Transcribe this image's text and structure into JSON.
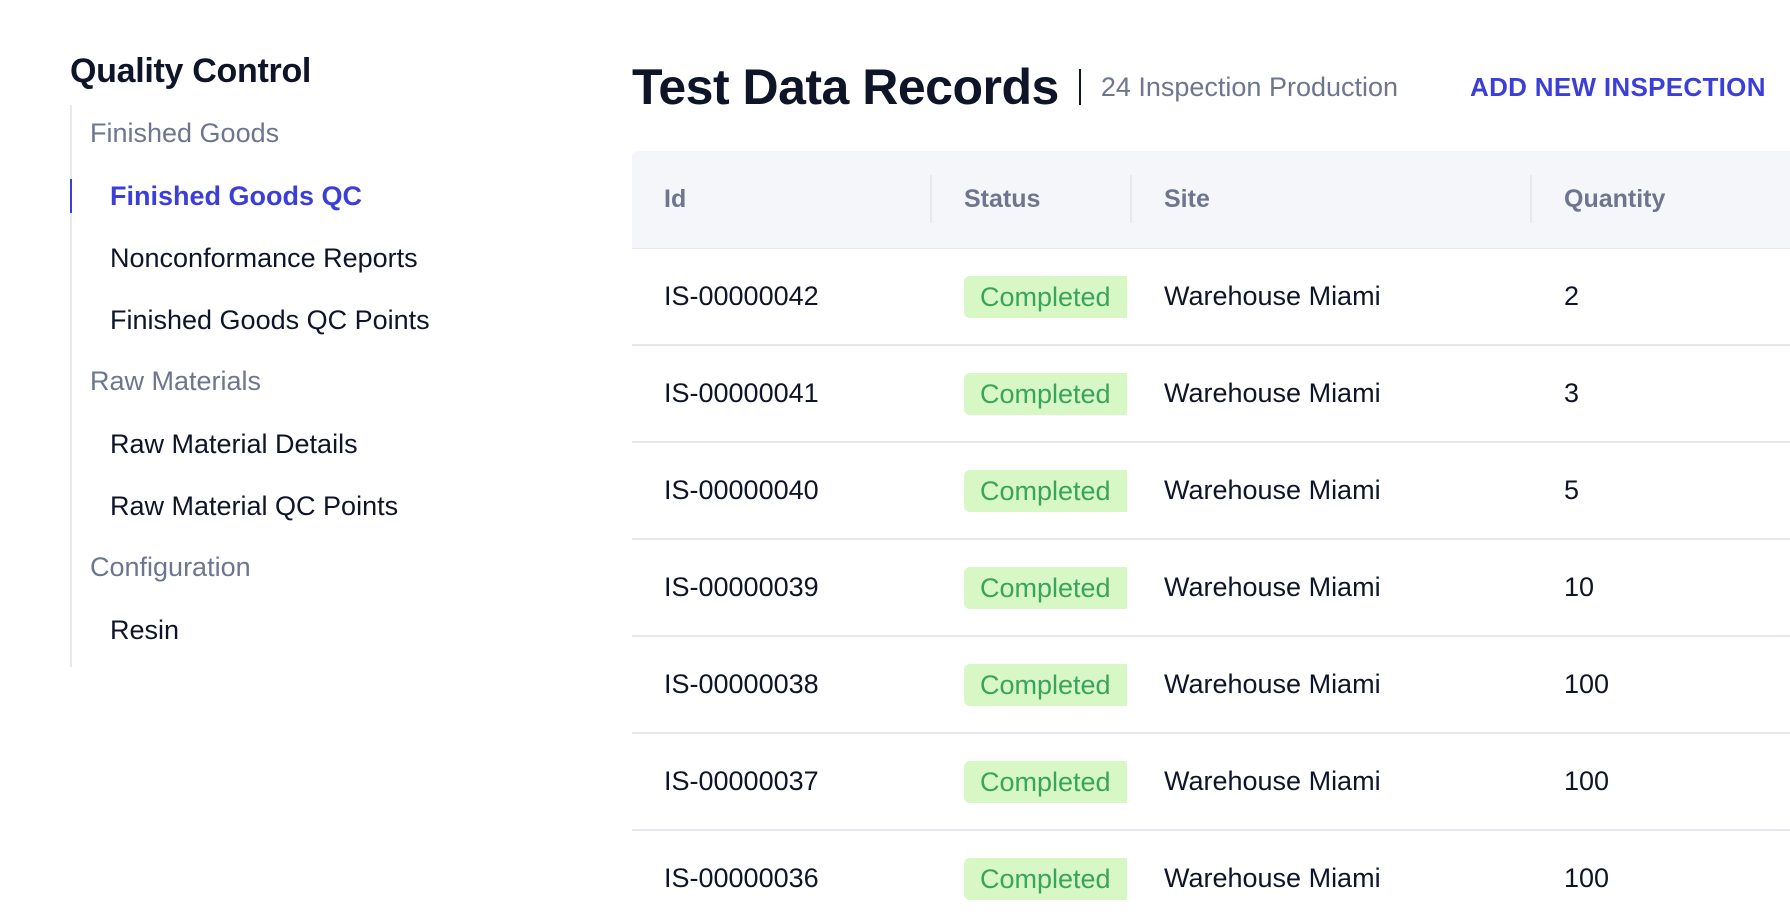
{
  "sidebar": {
    "title": "Quality Control",
    "groups": [
      {
        "label": "Finished Goods",
        "items": [
          {
            "label": "Finished Goods QC",
            "active": true
          },
          {
            "label": "Nonconformance Reports",
            "active": false
          },
          {
            "label": "Finished Goods QC Points",
            "active": false
          }
        ]
      },
      {
        "label": "Raw Materials",
        "items": [
          {
            "label": "Raw Material Details",
            "active": false
          },
          {
            "label": "Raw Material QC Points",
            "active": false
          }
        ]
      },
      {
        "label": "Configuration",
        "items": [
          {
            "label": "Resin",
            "active": false
          }
        ]
      }
    ]
  },
  "header": {
    "title": "Test Data Records",
    "subtitle": "24 Inspection Production",
    "add_button": "ADD NEW INSPECTION"
  },
  "table": {
    "columns": [
      "Id",
      "Status",
      "Site",
      "Quantity"
    ],
    "rows": [
      {
        "id": "IS-00000042",
        "status": "Completed",
        "site": "Warehouse Miami",
        "quantity": "2"
      },
      {
        "id": "IS-00000041",
        "status": "Completed",
        "site": "Warehouse Miami",
        "quantity": "3"
      },
      {
        "id": "IS-00000040",
        "status": "Completed",
        "site": "Warehouse Miami",
        "quantity": "5"
      },
      {
        "id": "IS-00000039",
        "status": "Completed",
        "site": "Warehouse Miami",
        "quantity": "10"
      },
      {
        "id": "IS-00000038",
        "status": "Completed",
        "site": "Warehouse Miami",
        "quantity": "100"
      },
      {
        "id": "IS-00000037",
        "status": "Completed",
        "site": "Warehouse Miami",
        "quantity": "100"
      },
      {
        "id": "IS-00000036",
        "status": "Completed",
        "site": "Warehouse Miami",
        "quantity": "100"
      }
    ]
  },
  "colors": {
    "accent": "#3b3fd8",
    "text": "#0f1528",
    "muted": "#6d758f",
    "header_bg": "#f4f6fa",
    "badge_bg": "#d7f8c4",
    "badge_text": "#3aa55a"
  }
}
